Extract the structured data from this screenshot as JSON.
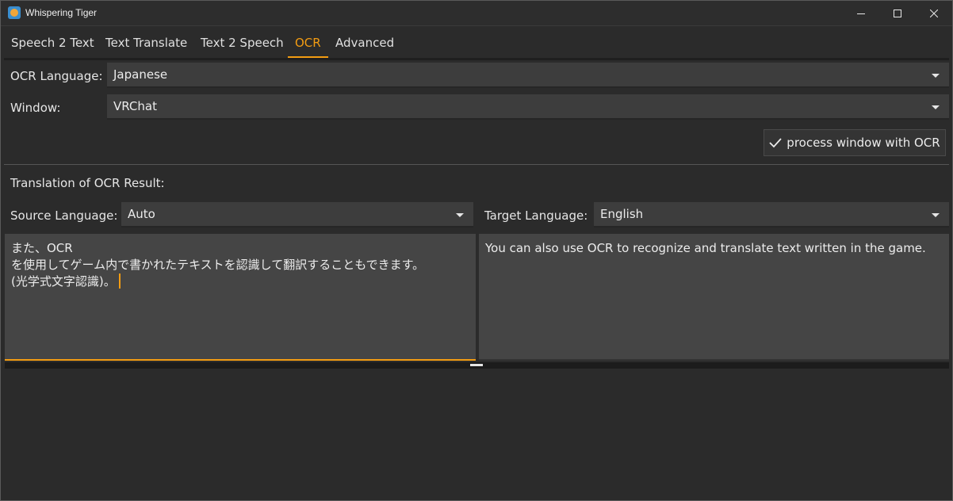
{
  "window": {
    "title": "Whispering Tiger",
    "icons": {
      "app": "tiger-app-icon",
      "minimize": "minimize-icon",
      "maximize": "maximize-icon",
      "close": "close-icon"
    }
  },
  "tabs": [
    {
      "label": "Speech 2 Text"
    },
    {
      "label": "Text Translate"
    },
    {
      "label": "Text 2 Speech"
    },
    {
      "label": "OCR",
      "active": true
    },
    {
      "label": "Advanced"
    }
  ],
  "ocr": {
    "language_label": "OCR Language:",
    "language_value": "Japanese",
    "window_label": "Window:",
    "window_value": "VRChat",
    "process_button_label": "process window with OCR",
    "process_button_icon": "checkmark-icon"
  },
  "translation": {
    "section_title": "Translation of OCR Result:",
    "source_label": "Source Language:",
    "source_value": "Auto",
    "target_label": "Target Language:",
    "target_value": "English",
    "source_text": "また、OCR\nを使用してゲーム内で書かれたテキストを認識して翻訳することもできます。\n(光学式文字認識)。",
    "target_text": "You can also use OCR to recognize and translate text written in the game."
  },
  "colors": {
    "accent": "#f39c12",
    "background": "#2b2b2b",
    "input_background": "#3d3d3d",
    "textbox_background": "#454545"
  }
}
